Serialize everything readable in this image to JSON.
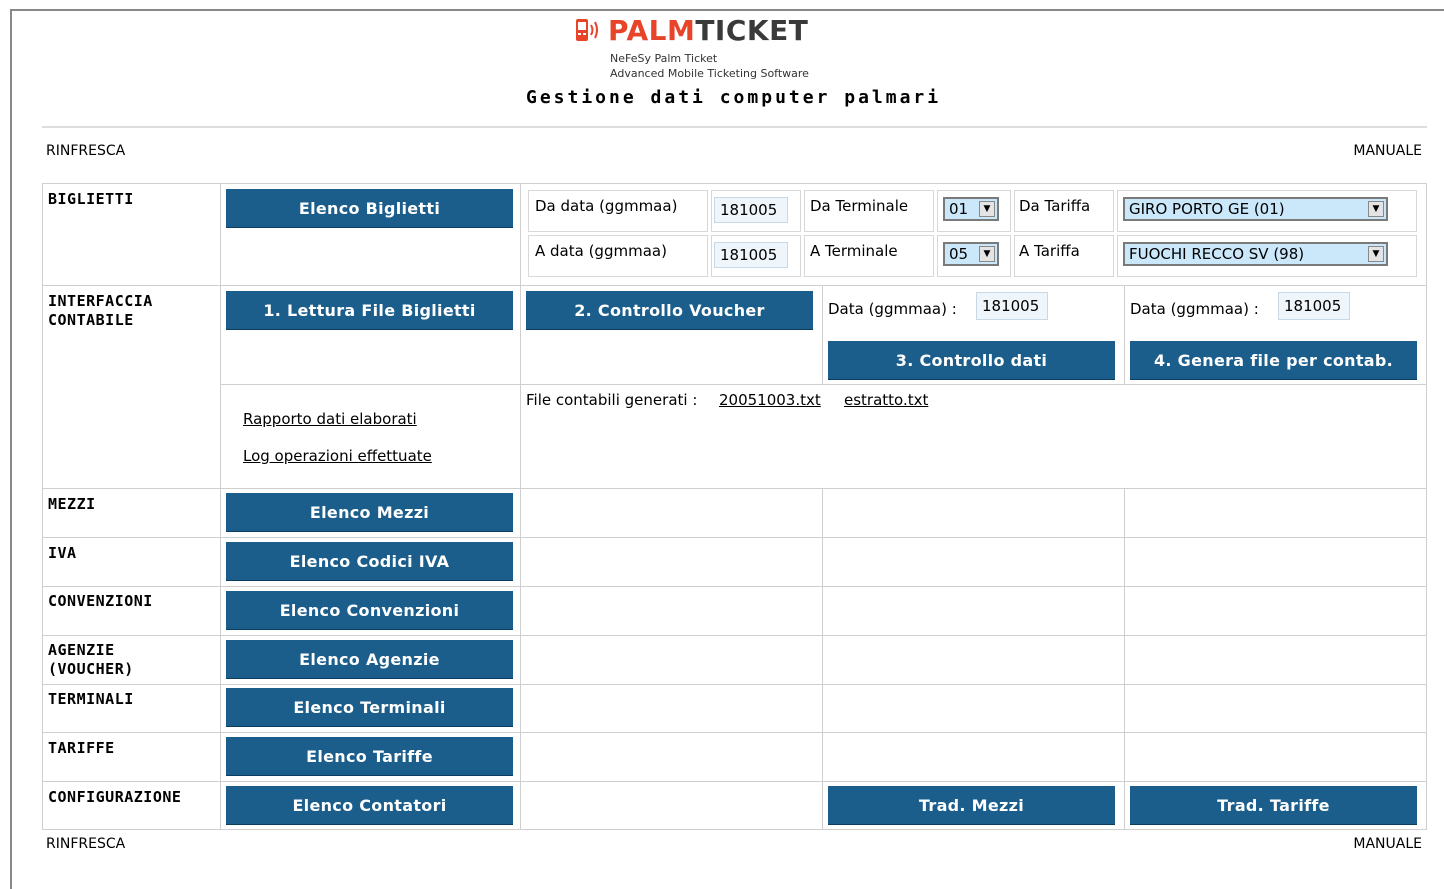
{
  "header": {
    "logo_palm": "PALM",
    "logo_ticket": "TICKET",
    "subtitle1": "NeFeSy Palm Ticket",
    "subtitle2": "Advanced Mobile Ticketing Software",
    "title": "Gestione dati computer palmari"
  },
  "toplinks": {
    "refresh": "RINFRESCA",
    "manual": "MANUALE"
  },
  "bottomlinks": {
    "refresh": "RINFRESCA",
    "manual": "MANUALE"
  },
  "biglietti": {
    "label": "BIGLIETTI",
    "button": "Elenco Biglietti",
    "da_data_label": "Da data (ggmmaa)",
    "da_data_value": "181005",
    "a_data_label": "A data (ggmmaa)",
    "a_data_value": "181005",
    "da_terminale_label": "Da Terminale",
    "da_terminale_value": "01",
    "a_terminale_label": "A Terminale",
    "a_terminale_value": "05",
    "da_tariffa_label": "Da Tariffa",
    "da_tariffa_value": "GIRO PORTO GE (01)",
    "a_tariffa_label": "A Tariffa",
    "a_tariffa_value": "FUOCHI RECCO SV (98)"
  },
  "interfaccia": {
    "label_line1": "INTERFACCIA",
    "label_line2": "CONTABILE",
    "btn1": "1. Lettura File Biglietti",
    "btn2": "2. Controllo Voucher",
    "data_label1": "Data (ggmmaa) :",
    "data_value1": "181005",
    "data_label2": "Data (ggmmaa) :",
    "data_value2": "181005",
    "btn3": "3. Controllo dati",
    "btn4": "4. Genera file per contab.",
    "link_rapporto": "Rapporto dati elaborati",
    "link_log": "Log operazioni effettuate",
    "files_label": "File contabili generati :",
    "file1": "20051003.txt",
    "file2": "estratto.txt"
  },
  "rows": [
    {
      "label": "MEZZI",
      "button": "Elenco Mezzi"
    },
    {
      "label": "IVA",
      "button": "Elenco Codici IVA"
    },
    {
      "label": "CONVENZIONI",
      "button": "Elenco Convenzioni"
    },
    {
      "label_line1": "AGENZIE",
      "label_line2": "(VOUCHER)",
      "button": "Elenco Agenzie"
    },
    {
      "label": "TERMINALI",
      "button": "Elenco Terminali"
    },
    {
      "label": "TARIFFE",
      "button": "Elenco Tariffe"
    },
    {
      "label": "CONFIGURAZIONE",
      "button": "Elenco Contatori",
      "btn_mezzi": "Trad. Mezzi",
      "btn_tariffe": "Trad. Tariffe"
    }
  ],
  "colors": {
    "button": "#1b5e8c",
    "logo_red": "#e8442a",
    "select_bg": "#cbe8fb"
  }
}
